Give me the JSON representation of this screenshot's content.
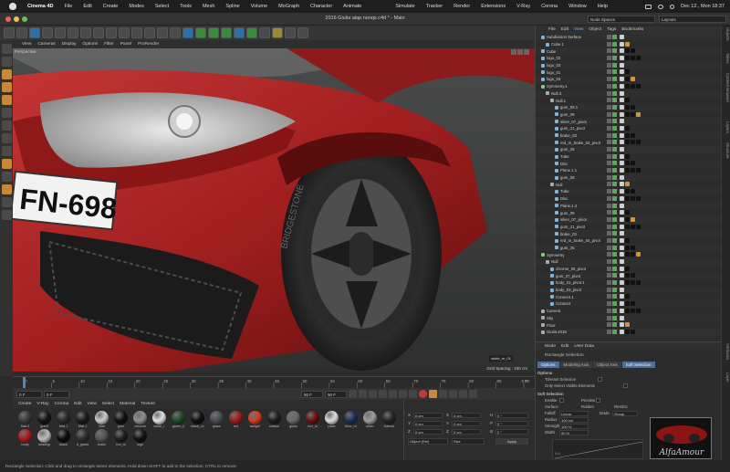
{
  "menubar": {
    "app": "Cinema 4D",
    "items": [
      "File",
      "Edit",
      "Create",
      "Modes",
      "Select",
      "Tools",
      "Mesh",
      "Spline",
      "Volume",
      "MoGraph",
      "Character",
      "Animate",
      "Simulate",
      "Tracker",
      "Render",
      "Extensions",
      "V-Ray",
      "Corona",
      "Window",
      "Help"
    ],
    "clock": "Dec 12., Mon 18:37"
  },
  "titlebar": {
    "title": "2016 Giulia alap nonqs.c4d * - Main",
    "node_spaces": "Node Spaces",
    "layouts": "Layouts"
  },
  "viewport": {
    "menu": [
      "View",
      "Cameras",
      "Display",
      "Options",
      "Filter",
      "Panel",
      "ProRender"
    ],
    "label": "Perspective",
    "grid_spacing": "Grid Spacing : 100 cm",
    "plate": "FN-698",
    "tire_brand": "BRIDGESTONE",
    "object_label": "white_rn_01"
  },
  "timeline": {
    "ticks": [
      "0",
      "5",
      "10",
      "15",
      "20",
      "25",
      "30",
      "35",
      "40",
      "45",
      "50",
      "55",
      "60",
      "65",
      "70",
      "75",
      "80",
      "85",
      "90"
    ],
    "end_label": "0 F",
    "start_field": "0 F",
    "start_field2": "0 F",
    "end_field": "90 F",
    "end_field2": "90 F"
  },
  "materials": {
    "menu": [
      "Create",
      "V-Ray",
      "Corona",
      "Edit",
      "View",
      "Select",
      "Material",
      "Texture"
    ],
    "items": [
      {
        "label": "Mat.2",
        "color": "#3a3a3a"
      },
      {
        "label": "gumf",
        "color": "#151515"
      },
      {
        "label": "Mat.1",
        "color": "#2a2a2a"
      },
      {
        "label": "Mat.1",
        "color": "#1c1c1c"
      },
      {
        "label": "Mat",
        "color": "#c9c9c9"
      },
      {
        "label": "gum",
        "color": "#101010"
      },
      {
        "label": "chrome",
        "color": "#8f8f8f"
      },
      {
        "label": "white_r",
        "color": "#e2e2e2"
      },
      {
        "label": "green_li",
        "color": "#1f4a26"
      },
      {
        "label": "black_m",
        "color": "#111111"
      },
      {
        "label": "glass",
        "color": "#4a4f55"
      },
      {
        "label": "red",
        "color": "#a01c1c"
      },
      {
        "label": "tailight",
        "color": "#d43d1f"
      },
      {
        "label": "carbon",
        "color": "#1e1e1e"
      },
      {
        "label": "glass",
        "color": "#6a6a6a"
      },
      {
        "label": "red_m",
        "color": "#6c1010"
      },
      {
        "label": "plate",
        "color": "#dcdcdc"
      },
      {
        "label": "blue_m",
        "color": "#1c2f5c"
      },
      {
        "label": "silver",
        "color": "#9d9d9d"
      },
      {
        "label": "Interior",
        "color": "#262626"
      },
      {
        "label": "body",
        "color": "#b01b1b"
      },
      {
        "label": "headligt",
        "color": "#bdbdbd"
      },
      {
        "label": "black",
        "color": "#0c0c0c"
      },
      {
        "label": "d_glass",
        "color": "#2e2e2e"
      },
      {
        "label": "brake",
        "color": "#555555"
      },
      {
        "label": "rov_m",
        "color": "#202020"
      },
      {
        "label": "logo",
        "color": "#121212"
      }
    ]
  },
  "coords": {
    "labels_pos": [
      "X",
      "Y",
      "Z"
    ],
    "labels_rot": [
      "H",
      "P",
      "B"
    ],
    "value": "0 cm",
    "rot_value": "0 °",
    "mode": "Object (Rel)",
    "size_mode": "Size",
    "apply": "Apply"
  },
  "object_manager": {
    "menu": [
      "File",
      "Edit",
      "View",
      "Object",
      "Tags",
      "Bookmarks"
    ],
    "rows": [
      {
        "name": "Subdivision Surface",
        "indent": 0,
        "color": "#7fb3d9"
      },
      {
        "name": "Cube.1",
        "indent": 1,
        "color": "#7fb3d9"
      },
      {
        "name": "Cube",
        "indent": 0,
        "color": "#7fb3d9"
      },
      {
        "name": "logo_02",
        "indent": 0,
        "color": "#7fb3d9"
      },
      {
        "name": "logo_03",
        "indent": 0,
        "color": "#7fb3d9"
      },
      {
        "name": "logo_01",
        "indent": 0,
        "color": "#7fb3d9"
      },
      {
        "name": "logo_03",
        "indent": 0,
        "color": "#7fb3d9"
      },
      {
        "name": "Symmetry.1",
        "indent": 0,
        "color": "#7fc77f"
      },
      {
        "name": "Null.3",
        "indent": 1,
        "color": "#aaaaaa"
      },
      {
        "name": "Null.1",
        "indent": 2,
        "color": "#aaaaaa"
      },
      {
        "name": "gum_09.1",
        "indent": 3,
        "color": "#7fb3d9"
      },
      {
        "name": "gum_09",
        "indent": 3,
        "color": "#7fb3d9"
      },
      {
        "name": "silver_07_pivot",
        "indent": 3,
        "color": "#7fb3d9"
      },
      {
        "name": "gum_21_pivot",
        "indent": 3,
        "color": "#7fb3d9"
      },
      {
        "name": "brake_03",
        "indent": 3,
        "color": "#7fb3d9"
      },
      {
        "name": "red_m_brake_04_pivot",
        "indent": 3,
        "color": "#7fb3d9"
      },
      {
        "name": "gum_25",
        "indent": 3,
        "color": "#7fb3d9"
      },
      {
        "name": "Tube",
        "indent": 3,
        "color": "#7fb3d9"
      },
      {
        "name": "Disc",
        "indent": 3,
        "color": "#7fb3d9"
      },
      {
        "name": "Plane.1.1",
        "indent": 3,
        "color": "#7fb3d9"
      },
      {
        "name": "gum_09",
        "indent": 3,
        "color": "#7fb3d9"
      },
      {
        "name": "Null",
        "indent": 2,
        "color": "#aaaaaa"
      },
      {
        "name": "Tube",
        "indent": 3,
        "color": "#7fb3d9"
      },
      {
        "name": "Disc",
        "indent": 3,
        "color": "#7fb3d9"
      },
      {
        "name": "Plane.1.3",
        "indent": 3,
        "color": "#7fb3d9"
      },
      {
        "name": "gum_09",
        "indent": 3,
        "color": "#7fb3d9"
      },
      {
        "name": "silver_07_pivot",
        "indent": 3,
        "color": "#7fb3d9"
      },
      {
        "name": "gum_21_pivot",
        "indent": 3,
        "color": "#7fb3d9"
      },
      {
        "name": "brake_03",
        "indent": 3,
        "color": "#7fb3d9"
      },
      {
        "name": "red_m_brake_04_pivot",
        "indent": 3,
        "color": "#7fb3d9"
      },
      {
        "name": "gum_25",
        "indent": 3,
        "color": "#7fb3d9"
      },
      {
        "name": "Symmetry",
        "indent": 0,
        "color": "#7fc77f"
      },
      {
        "name": "Null",
        "indent": 1,
        "color": "#aaaaaa"
      },
      {
        "name": "chrome_06_pivot",
        "indent": 2,
        "color": "#7fb3d9"
      },
      {
        "name": "gum_37_pivot",
        "indent": 2,
        "color": "#7fb3d9"
      },
      {
        "name": "body_01_pivot.1",
        "indent": 2,
        "color": "#7fb3d9"
      },
      {
        "name": "body_03_pivot",
        "indent": 2,
        "color": "#7fb3d9"
      },
      {
        "name": "Connect.1",
        "indent": 2,
        "color": "#7fb3d9"
      },
      {
        "name": "Connect",
        "indent": 2,
        "color": "#7fb3d9"
      },
      {
        "name": "Camera",
        "indent": 0,
        "color": "#aaaaaa"
      },
      {
        "name": "Sky",
        "indent": 0,
        "color": "#aaaaaa"
      },
      {
        "name": "Floor",
        "indent": 0,
        "color": "#aaaaaa"
      },
      {
        "name": "Giulia 2016",
        "indent": 0,
        "color": "#aaaaaa"
      }
    ]
  },
  "attributes": {
    "menu": [
      "Mode",
      "Edit",
      "User Data"
    ],
    "tool": "Rectangle Selection",
    "tabs": [
      "Options",
      "Modeling Axis",
      "Object Axis",
      "Soft Selection"
    ],
    "options_title": "Options",
    "tolerant": "Tolerant Selection",
    "only_visible": "Only Select Visible Elements",
    "soft_title": "Soft Selection",
    "enable": "Enable",
    "preview": "Preview",
    "surface": "Surface",
    "rubber": "Rubber",
    "restrict": "Restrict",
    "falloff": "Falloff",
    "falloff_value": "Linear",
    "mode": "Mode",
    "mode_value": "Group",
    "radius": "Radius",
    "radius_value": "100 cm",
    "strength": "Strength",
    "strength_value": "100 %",
    "width": "Width",
    "width_value": "50 %",
    "graph_value": "0.8"
  },
  "sidestrip": [
    "Objects",
    "Takes",
    "Content Browser",
    "Layers",
    "Structure",
    "Attributes",
    "Layer"
  ],
  "status": "Rectangle Selection: Click and drag to rectangle-select elements. Hold down SHIFT to add to the selection, CTRL to remove.",
  "watermark": "AlfaAmour"
}
